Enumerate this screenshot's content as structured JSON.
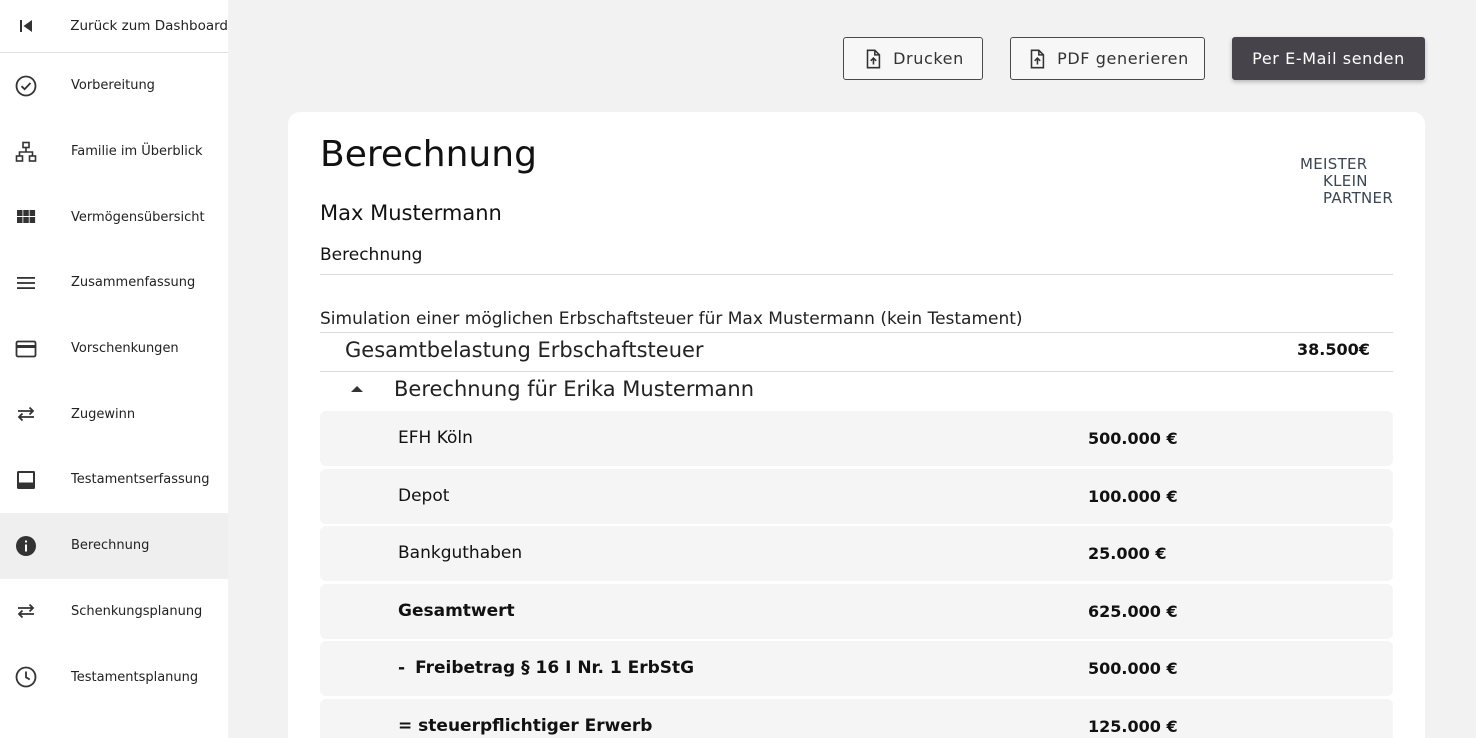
{
  "sidebar": {
    "back_label": "Zurück zum Dashboard",
    "items": [
      {
        "label": "Vorbereitung",
        "icon": "check-circle-icon"
      },
      {
        "label": "Familie im Überblick",
        "icon": "org-chart-icon"
      },
      {
        "label": "Vermögensübersicht",
        "icon": "grid-icon"
      },
      {
        "label": "Zusammenfassung",
        "icon": "menu-lines-icon"
      },
      {
        "label": "Vorschenkungen",
        "icon": "credit-card-icon"
      },
      {
        "label": "Zugewinn",
        "icon": "swap-arrows-icon"
      },
      {
        "label": "Testamentserfassung",
        "icon": "inbox-icon"
      },
      {
        "label": "Berechnung",
        "icon": "info-icon",
        "active": true
      },
      {
        "label": "Schenkungsplanung",
        "icon": "swap-arrows-icon"
      },
      {
        "label": "Testamentsplanung",
        "icon": "clock-icon"
      }
    ]
  },
  "toolbar": {
    "print_label": "Drucken",
    "pdf_label": "PDF generieren",
    "mail_label": "Per E-Mail senden"
  },
  "card": {
    "title": "Berechnung",
    "person": "Max Mustermann",
    "subtitle": "Berechnung",
    "logo": [
      "MEISTER",
      "KLEIN",
      "PARTNER"
    ],
    "simulation_text": "Simulation einer möglichen Erbschaftsteuer für Max Mustermann (kein Testament)",
    "total_label": "Gesamtbelastung Erbschaftsteuer",
    "total_value": "38.500€",
    "section_label": "Berechnung für Erika Mustermann",
    "rows": [
      {
        "label": "EFH Köln",
        "value": "500.000 €"
      },
      {
        "label": "Depot",
        "value": "100.000 €"
      },
      {
        "label": "Bankguthaben",
        "value": "25.000 €"
      },
      {
        "label": "Gesamtwert",
        "value": "625.000 €"
      },
      {
        "prefix": "-",
        "label": "Freibetrag § 16 I Nr. 1 ErbStG",
        "value": "500.000 €"
      },
      {
        "label": "= steuerpflichtiger Erwerb",
        "value": "125.000 €"
      }
    ]
  },
  "colors": {
    "primary_button": "#47434a",
    "logo_text": "#3c4652",
    "active_nav": "#efefef"
  }
}
